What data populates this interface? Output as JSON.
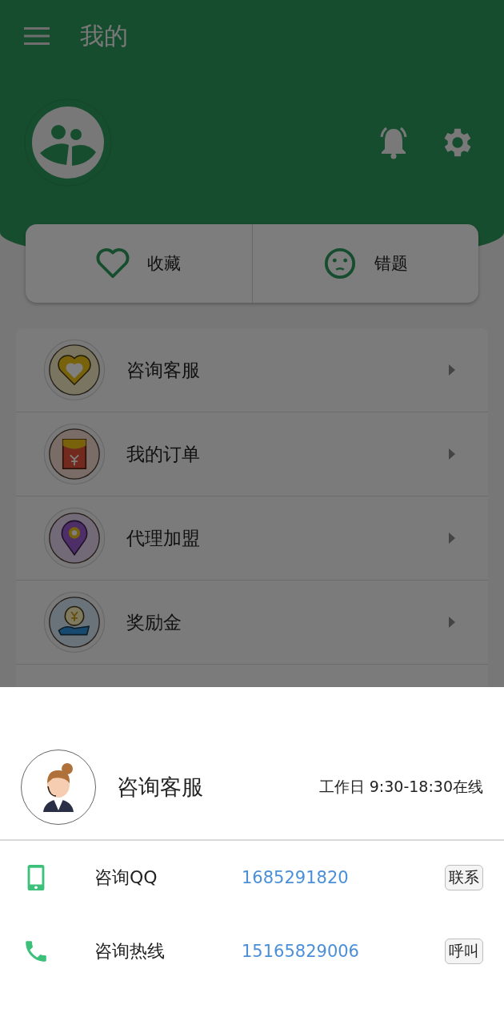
{
  "header": {
    "title": "我的"
  },
  "quick_actions": [
    {
      "kind": "heart",
      "label": "收藏"
    },
    {
      "kind": "sad",
      "label": "错题"
    }
  ],
  "menu": [
    {
      "kind": "heart",
      "label": "咨询客服"
    },
    {
      "kind": "envelope",
      "label": "我的订单"
    },
    {
      "kind": "pin",
      "label": "代理加盟"
    },
    {
      "kind": "coin",
      "label": "奖励金"
    }
  ],
  "sheet": {
    "title": "咨询客服",
    "hours": "工作日 9:30-18:30在线",
    "contacts": [
      {
        "kind": "mobile",
        "label": "咨询QQ",
        "number": "1685291820",
        "action": "联系"
      },
      {
        "kind": "phone",
        "label": "咨询热线",
        "number": "15165829006",
        "action": "呼叫"
      }
    ]
  }
}
